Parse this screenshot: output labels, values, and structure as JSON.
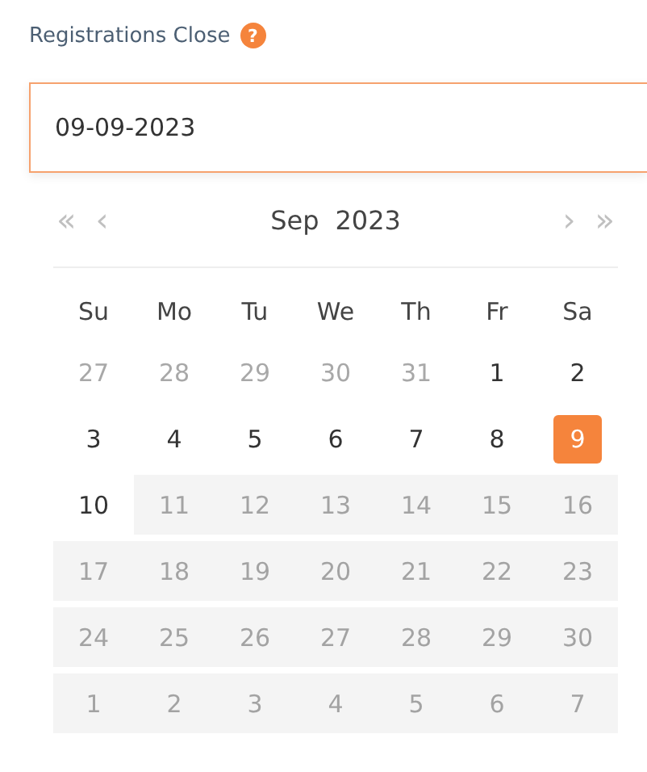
{
  "field": {
    "label": "Registrations Close",
    "help_icon": "?",
    "value": "09-09-2023"
  },
  "calendar": {
    "nav": {
      "prev_year": "«",
      "prev_month": "‹",
      "next_month": "›",
      "next_year": "»"
    },
    "month": "Sep",
    "year": "2023",
    "weekdays": [
      "Su",
      "Mo",
      "Tu",
      "We",
      "Th",
      "Fr",
      "Sa"
    ],
    "days": [
      {
        "label": "27",
        "kind": "adjacent",
        "selected": false
      },
      {
        "label": "28",
        "kind": "adjacent",
        "selected": false
      },
      {
        "label": "29",
        "kind": "adjacent",
        "selected": false
      },
      {
        "label": "30",
        "kind": "adjacent",
        "selected": false
      },
      {
        "label": "31",
        "kind": "adjacent",
        "selected": false
      },
      {
        "label": "1",
        "kind": "current",
        "selected": false
      },
      {
        "label": "2",
        "kind": "current",
        "selected": false
      },
      {
        "label": "3",
        "kind": "current",
        "selected": false
      },
      {
        "label": "4",
        "kind": "current",
        "selected": false
      },
      {
        "label": "5",
        "kind": "current",
        "selected": false
      },
      {
        "label": "6",
        "kind": "current",
        "selected": false
      },
      {
        "label": "7",
        "kind": "current",
        "selected": false
      },
      {
        "label": "8",
        "kind": "current",
        "selected": false
      },
      {
        "label": "9",
        "kind": "current",
        "selected": true
      },
      {
        "label": "10",
        "kind": "current",
        "selected": false
      },
      {
        "label": "11",
        "kind": "disabled",
        "selected": false
      },
      {
        "label": "12",
        "kind": "disabled",
        "selected": false
      },
      {
        "label": "13",
        "kind": "disabled",
        "selected": false
      },
      {
        "label": "14",
        "kind": "disabled",
        "selected": false
      },
      {
        "label": "15",
        "kind": "disabled",
        "selected": false
      },
      {
        "label": "16",
        "kind": "disabled",
        "selected": false
      },
      {
        "label": "17",
        "kind": "disabled",
        "selected": false
      },
      {
        "label": "18",
        "kind": "disabled",
        "selected": false
      },
      {
        "label": "19",
        "kind": "disabled",
        "selected": false
      },
      {
        "label": "20",
        "kind": "disabled",
        "selected": false
      },
      {
        "label": "21",
        "kind": "disabled",
        "selected": false
      },
      {
        "label": "22",
        "kind": "disabled",
        "selected": false
      },
      {
        "label": "23",
        "kind": "disabled",
        "selected": false
      },
      {
        "label": "24",
        "kind": "disabled",
        "selected": false
      },
      {
        "label": "25",
        "kind": "disabled",
        "selected": false
      },
      {
        "label": "26",
        "kind": "disabled",
        "selected": false
      },
      {
        "label": "27",
        "kind": "disabled",
        "selected": false
      },
      {
        "label": "28",
        "kind": "disabled",
        "selected": false
      },
      {
        "label": "29",
        "kind": "disabled",
        "selected": false
      },
      {
        "label": "30",
        "kind": "disabled",
        "selected": false
      },
      {
        "label": "1",
        "kind": "disabled",
        "selected": false
      },
      {
        "label": "2",
        "kind": "disabled",
        "selected": false
      },
      {
        "label": "3",
        "kind": "disabled",
        "selected": false
      },
      {
        "label": "4",
        "kind": "disabled",
        "selected": false
      },
      {
        "label": "5",
        "kind": "disabled",
        "selected": false
      },
      {
        "label": "6",
        "kind": "disabled",
        "selected": false
      },
      {
        "label": "7",
        "kind": "disabled",
        "selected": false
      }
    ]
  }
}
